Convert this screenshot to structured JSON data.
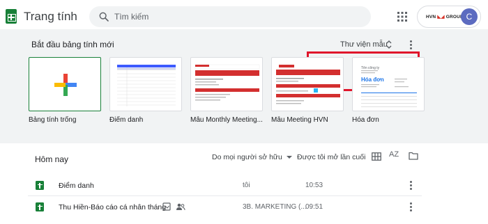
{
  "header": {
    "app_title": "Trang tính",
    "search_placeholder": "Tìm kiếm",
    "org_logo_text": "HVN GROUP",
    "avatar_letter": "C",
    "brand_color": "#188038"
  },
  "gallery": {
    "heading": "Bắt đầu bảng tính mới",
    "template_gallery_label": "Thư viện mẫu",
    "templates": [
      {
        "label": "Bảng tính trống"
      },
      {
        "label": "Điểm danh"
      },
      {
        "label": "Mẫu Monthly Meeting..."
      },
      {
        "label": "Mẫu Meeting HVN"
      },
      {
        "label": "Hóa đơn"
      }
    ],
    "invoice_thumb": {
      "company": "Tên công ty",
      "title": "Hóa đơn"
    },
    "highlight_color": "#e0152b"
  },
  "recent": {
    "title": "Hôm nay",
    "owner_filter": "Do mọi người sở hữu",
    "sort_label": "Được tôi mở lần cuối",
    "sort_icon_text": "AZ",
    "files": [
      {
        "name": "Điểm danh",
        "owner": "tôi",
        "time": "10:53"
      },
      {
        "name": "Thu Hiền-Báo cáo cá nhân tháng",
        "owner": "3B. MARKETING (...",
        "time": "09:51"
      }
    ]
  }
}
